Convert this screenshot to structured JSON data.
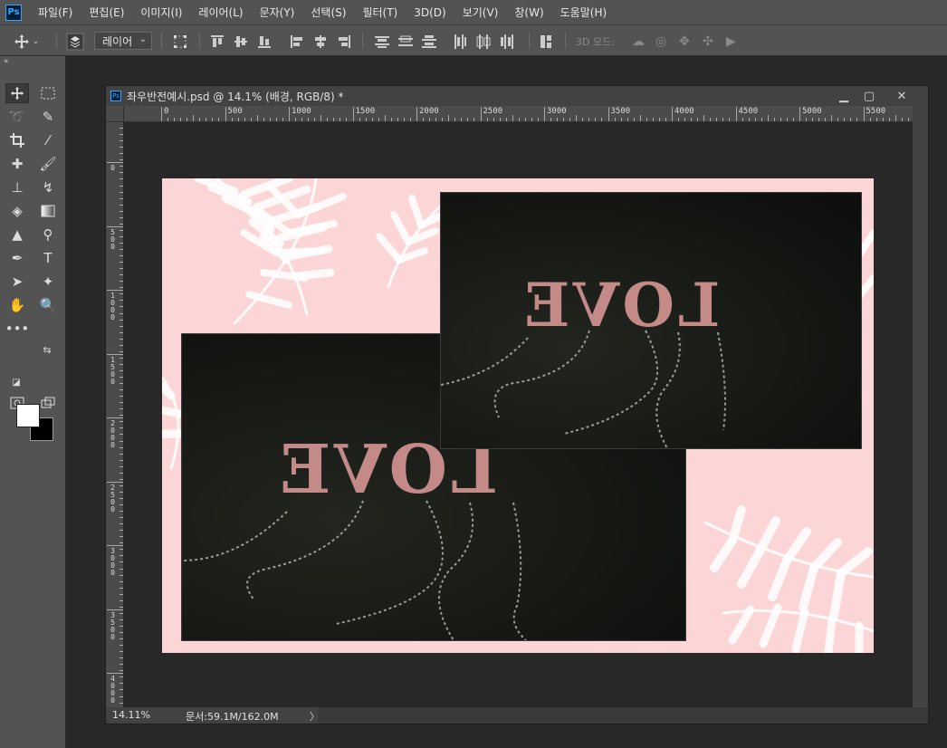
{
  "app": {
    "logo": "Ps"
  },
  "menu": [
    "파일(F)",
    "편집(E)",
    "이미지(I)",
    "레이어(L)",
    "문자(Y)",
    "선택(S)",
    "필터(T)",
    "3D(D)",
    "보기(V)",
    "창(W)",
    "도움말(H)"
  ],
  "options": {
    "auto_select_value": "레이어",
    "mode_3d_label": "3D 모드:"
  },
  "document": {
    "title": "좌우반전예시.psd @ 14.1% (배경, RGB/8) *",
    "zoom": "14.11%",
    "doc_size": "문서:59.1M/162.0M",
    "status_arrow": "〉"
  },
  "rulers": {
    "horizontal": [
      "0",
      "500",
      "1000",
      "1500",
      "2000",
      "2500",
      "3000",
      "3500",
      "4000",
      "4500",
      "5000",
      "5500"
    ],
    "vertical": [
      "0",
      "0",
      "500",
      "1000",
      "1500",
      "2000",
      "2500",
      "3000",
      "3500",
      "4000"
    ]
  },
  "image": {
    "photo_text_1": "LOVE",
    "photo_text_2": "LOVE",
    "background_color": "#fcd6d7",
    "letter_color": "#c38a88"
  },
  "icons": [
    "move-tool-icon",
    "marquee-tool-icon",
    "lasso-tool-icon",
    "quick-select-tool-icon",
    "crop-tool-icon",
    "eyedropper-tool-icon",
    "healing-brush-icon",
    "brush-tool-icon",
    "stamp-tool-icon",
    "history-brush-icon",
    "eraser-tool-icon",
    "gradient-tool-icon",
    "blur-tool-icon",
    "dodge-tool-icon",
    "pen-tool-icon",
    "type-tool-icon",
    "path-select-tool-icon",
    "shape-tool-icon",
    "hand-tool-icon",
    "zoom-tool-icon"
  ]
}
